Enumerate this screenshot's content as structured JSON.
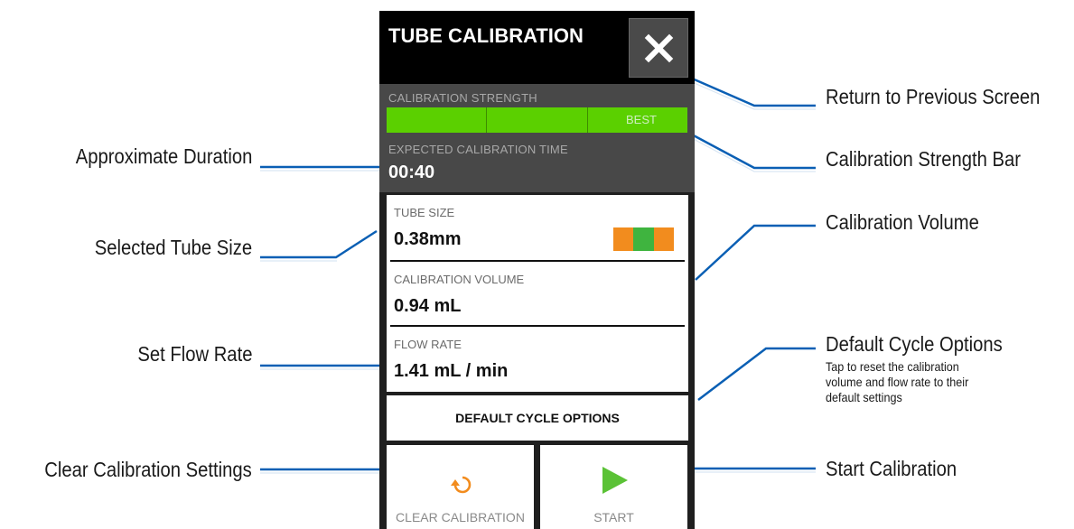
{
  "screen": {
    "title": "TUBE CALIBRATION",
    "close_icon": "close-icon",
    "calibration_strength": {
      "label": "CALIBRATION STRENGTH",
      "segments": 3,
      "level_label": "BEST",
      "filled_fraction": 1.0,
      "color": "#5bd000"
    },
    "expected_time": {
      "label": "EXPECTED CALIBRATION TIME",
      "value": "00:40"
    },
    "tube_size": {
      "label": "TUBE SIZE",
      "value": "0.38mm",
      "chip_colors": [
        "#f28c1e",
        "#3fb43f",
        "#f28c1e"
      ]
    },
    "calibration_volume": {
      "label": "CALIBRATION VOLUME",
      "value": "0.94 mL"
    },
    "flow_rate": {
      "label": "FLOW RATE",
      "value": "1.41 mL / min"
    },
    "default_cycle_button": "DEFAULT CYCLE OPTIONS",
    "clear_button": {
      "label": "CLEAR CALIBRATION",
      "icon": "reset-icon",
      "icon_color": "#f28c1e"
    },
    "start_button": {
      "label": "START",
      "icon": "play-icon",
      "icon_color": "#5bc236"
    }
  },
  "callouts": {
    "return": "Return to Previous Screen",
    "strength_bar": "Calibration Strength Bar",
    "volume": "Calibration Volume",
    "default_cycle": "Default Cycle Options",
    "default_cycle_desc_1": "Tap to reset the calibration",
    "default_cycle_desc_2": "volume and flow rate to their",
    "default_cycle_desc_3": "default settings",
    "start": "Start Calibration",
    "duration": "Approximate Duration",
    "tube_size": "Selected Tube Size",
    "flow_rate": "Set Flow Rate",
    "clear": "Clear Calibration Settings",
    "line_color": "#0a5fb4"
  }
}
